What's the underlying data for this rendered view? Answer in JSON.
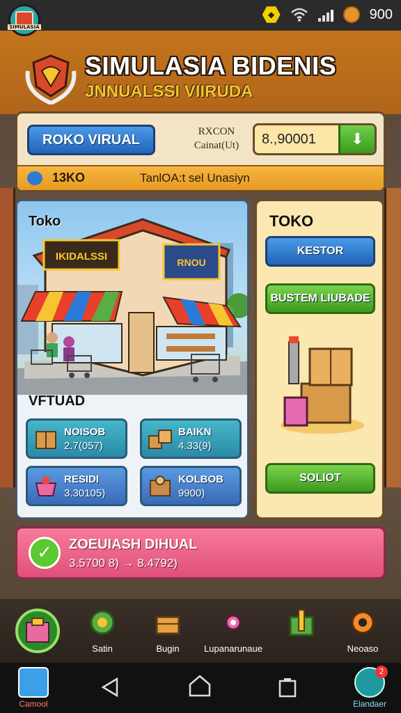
{
  "status_bar": {
    "right_value": "900"
  },
  "app_badge": {
    "tag": "SIMULASIA"
  },
  "header": {
    "title": "SIMULASIA BIDENIS",
    "subtitle": "JNNUALSSI VIIRUDA"
  },
  "control_panel": {
    "blue_button": "ROKO VIRUAL",
    "mid_label_line1": "RXCON",
    "mid_label_line2": "Cainat(Ut)",
    "value": "8.,90001",
    "info_code": "13KO",
    "info_desc": "TanlOA:t sel Unasiyn"
  },
  "store_panel": {
    "title": "Toko",
    "sign_left": "IKIDALSSI",
    "sign_right": "RNOU",
    "section_label": "VFTUAD",
    "items": [
      {
        "name": "NOISOB",
        "value": "2.7(057)"
      },
      {
        "name": "BAIKN",
        "value": "4.33(9)"
      },
      {
        "name": "RESIDI",
        "value": "3.30105)"
      },
      {
        "name": "KOLBOB",
        "value": "9900)"
      }
    ]
  },
  "right_panel": {
    "title": "TOKO",
    "btn1": "KESTOR",
    "btn2": "BUSTEM LIUBADE",
    "btn3": "SOLIOT"
  },
  "banner": {
    "title": "ZOEUIASH DIHUAL",
    "sub": "3.5700 8) → 8.4792)"
  },
  "bottom_nav": {
    "items": [
      {
        "label": ""
      },
      {
        "label": "Satin"
      },
      {
        "label": "Bugin"
      },
      {
        "label": "Lupanarunaue"
      },
      {
        "label": ""
      },
      {
        "label": "Neoaso"
      }
    ]
  },
  "system_nav": {
    "left_app": "Camool",
    "right_app": "Elandaer",
    "right_badge": "2"
  },
  "colors": {
    "header": "#c4741c",
    "accent_blue": "#2264b8",
    "accent_green": "#3e9a1e",
    "banner_pink": "#e0507a"
  }
}
